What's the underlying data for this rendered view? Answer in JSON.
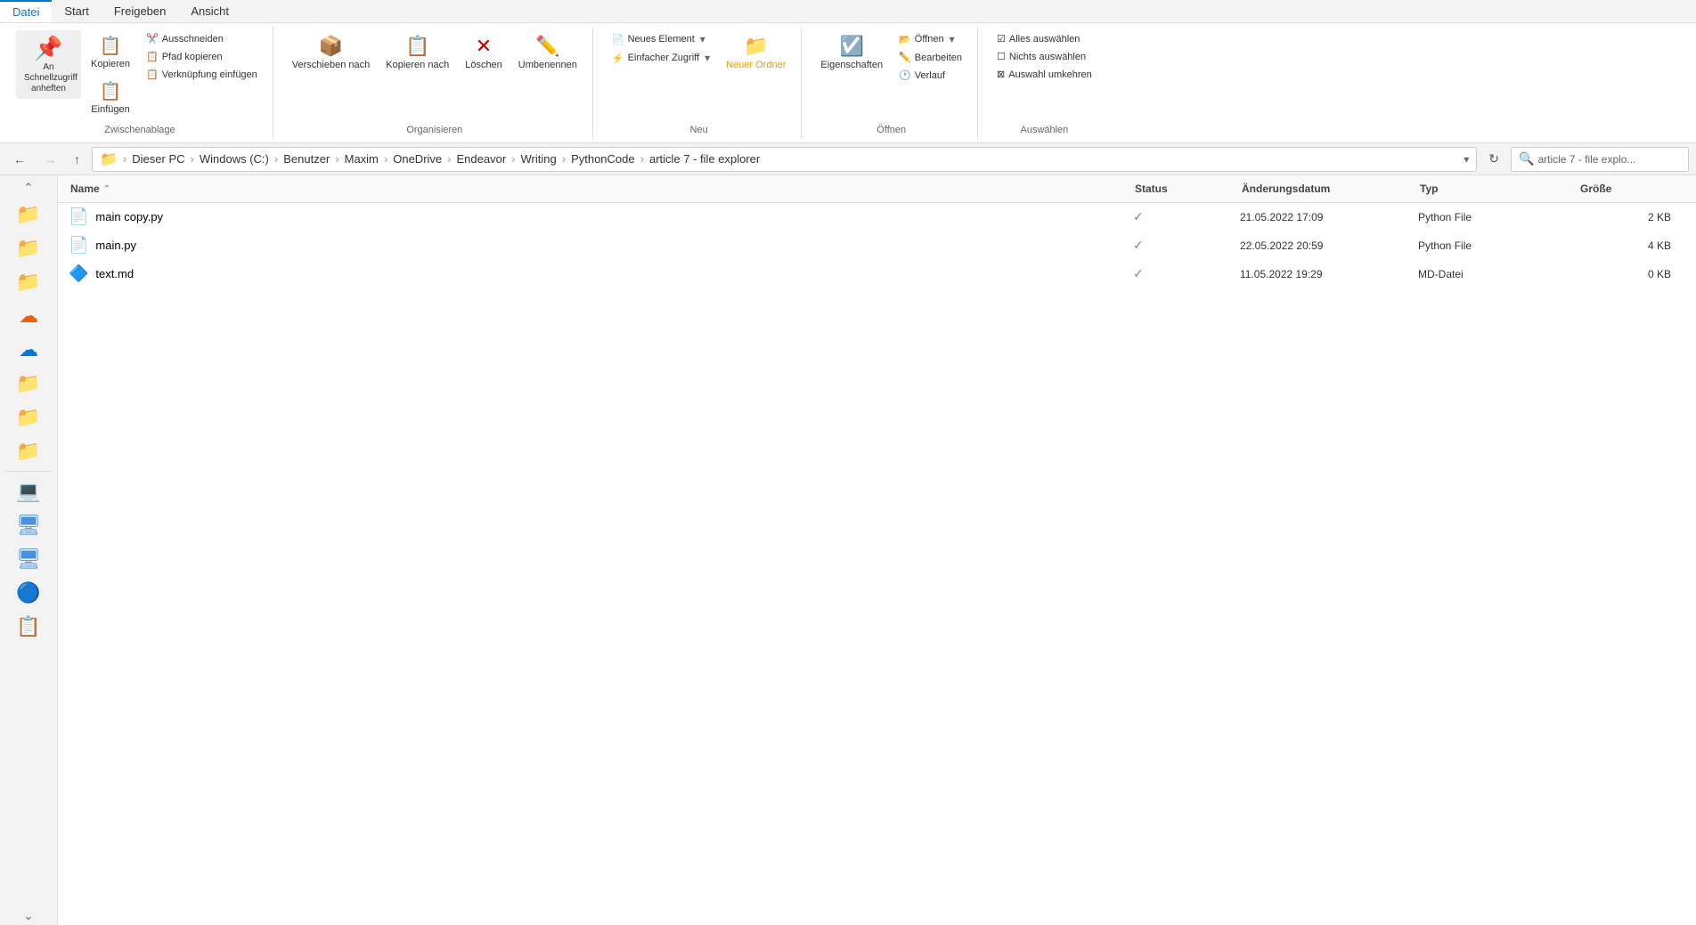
{
  "ribbon": {
    "tabs": [
      {
        "label": "Datei",
        "active": true
      },
      {
        "label": "Start",
        "active": false
      },
      {
        "label": "Freigeben",
        "active": false
      },
      {
        "label": "Ansicht",
        "active": false
      }
    ],
    "groups": {
      "clipboard": {
        "label": "Zwischenablage",
        "pin_label": "An Schnellzugriff anheften",
        "copy_label": "Kopieren",
        "paste_label": "Einfügen",
        "cut_label": "Ausschneiden",
        "path_copy_label": "Pfad kopieren",
        "shortcut_label": "Verknüpfung einfügen"
      },
      "organize": {
        "label": "Organisieren",
        "move_label": "Verschieben nach",
        "copy_label": "Kopieren nach",
        "delete_label": "Löschen",
        "rename_label": "Umbenennen"
      },
      "new": {
        "label": "Neu",
        "new_item_label": "Neues Element",
        "easy_access_label": "Einfacher Zugriff",
        "new_folder_label": "Neuer Ordner"
      },
      "open": {
        "label": "Öffnen",
        "open_label": "Öffnen",
        "edit_label": "Bearbeiten",
        "history_label": "Verlauf",
        "properties_label": "Eigenschaften"
      },
      "select": {
        "label": "Auswählen",
        "select_all_label": "Alles auswählen",
        "select_none_label": "Nichts auswählen",
        "invert_label": "Auswahl umkehren"
      }
    }
  },
  "address_bar": {
    "breadcrumb": [
      "Dieser PC",
      "Windows (C:)",
      "Benutzer",
      "Maxim",
      "OneDrive",
      "Endeavor",
      "Writing",
      "PythonCode",
      "article 7 - file explorer"
    ],
    "search_placeholder": "article 7 - file explo...",
    "search_value": "article 7 - file explo..."
  },
  "file_list": {
    "columns": [
      {
        "label": "Name",
        "sort": "asc"
      },
      {
        "label": "Status",
        "sort": null
      },
      {
        "label": "Änderungsdatum",
        "sort": null
      },
      {
        "label": "Typ",
        "sort": null
      },
      {
        "label": "Größe",
        "sort": null
      }
    ],
    "files": [
      {
        "name": "main copy.py",
        "icon": "📄",
        "status": "✓",
        "date": "21.05.2022 17:09",
        "type": "Python File",
        "size": "2 KB"
      },
      {
        "name": "main.py",
        "icon": "📄",
        "status": "✓",
        "date": "22.05.2022 20:59",
        "type": "Python File",
        "size": "4 KB"
      },
      {
        "name": "text.md",
        "icon": "🔷",
        "status": "✓",
        "date": "11.05.2022 19:29",
        "type": "MD-Datei",
        "size": "0 KB"
      }
    ]
  },
  "sidebar": {
    "items": [
      {
        "icon": "⬆",
        "name": "scroll-up"
      },
      {
        "icon": "📁",
        "name": "folder-yellow-1",
        "color": "#e8a000"
      },
      {
        "icon": "📁",
        "name": "folder-yellow-2",
        "color": "#e8a000"
      },
      {
        "icon": "📁",
        "name": "folder-yellow-3",
        "color": "#e8a000"
      },
      {
        "icon": "☁️",
        "name": "onedrive-orange"
      },
      {
        "icon": "☁️",
        "name": "onedrive-blue"
      },
      {
        "icon": "📁",
        "name": "folder-yellow-4",
        "color": "#e8a000"
      },
      {
        "icon": "📁",
        "name": "folder-yellow-5",
        "color": "#e8a000"
      },
      {
        "icon": "📁",
        "name": "folder-yellow-6",
        "color": "#e8a000"
      },
      {
        "icon": "💻",
        "name": "this-pc"
      },
      {
        "icon": "🖥",
        "name": "network-1"
      },
      {
        "icon": "🖥",
        "name": "network-2"
      },
      {
        "icon": "🔵",
        "name": "blue-item"
      },
      {
        "icon": "📋",
        "name": "list-item"
      }
    ]
  }
}
